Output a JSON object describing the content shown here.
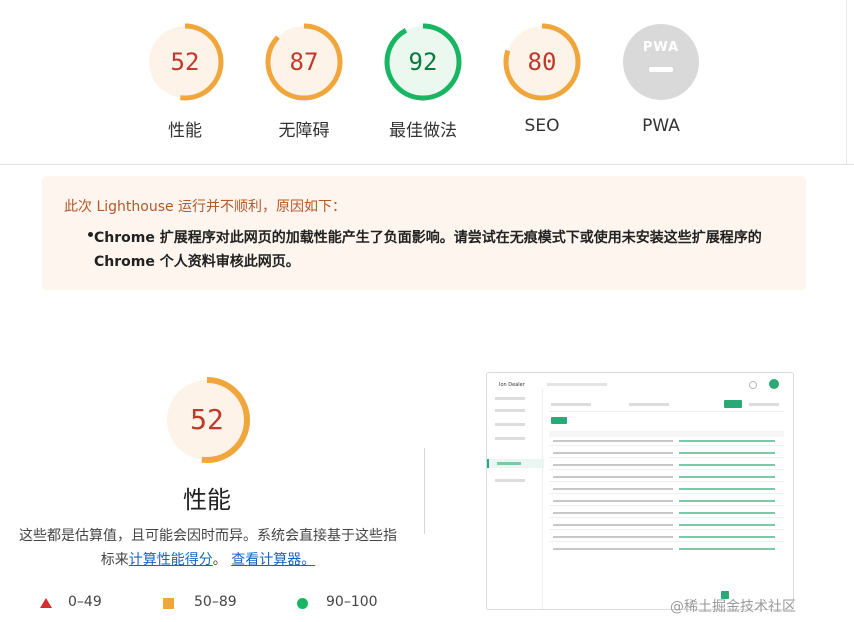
{
  "scores": [
    {
      "key": "performance",
      "value": "52",
      "label": "性能",
      "color": "#f0a63a",
      "fraction": 0.52
    },
    {
      "key": "accessibility",
      "value": "87",
      "label": "无障碍",
      "color": "#f0a63a",
      "fraction": 0.87
    },
    {
      "key": "best_practices",
      "value": "92",
      "label": "最佳做法",
      "color": "#18b663",
      "fraction": 0.92
    },
    {
      "key": "seo",
      "value": "80",
      "label": "SEO",
      "color": "#f0a63a",
      "fraction": 0.8
    },
    {
      "key": "pwa",
      "value": "PWA",
      "label": "PWA",
      "color": "#cccccc",
      "fraction": 0
    }
  ],
  "colors": {
    "orange": "#f0a63a",
    "green": "#18b663",
    "red": "#d32f2f",
    "text_orange": "#c0392b",
    "text_green": "#0b7a3e"
  },
  "warning": {
    "title": "此次 Lighthouse 运行并不顺利，原因如下：",
    "items": [
      "Chrome 扩展程序对此网页的加载性能产生了负面影响。请尝试在无痕模式下或使用未安装这些扩展程序的 Chrome 个人资料审核此网页。"
    ]
  },
  "performance": {
    "score": "52",
    "fraction": 0.52,
    "title": "性能",
    "desc_1": "这些都是估算值，且可能会因时而异。系统会直接基于这些指标来",
    "link_1": "计算性能得分",
    "desc_2": "。",
    "link_2": "查看计算器。"
  },
  "legend": [
    {
      "range": "0–49",
      "icon": "triangle-icon"
    },
    {
      "range": "50–89",
      "icon": "square-icon"
    },
    {
      "range": "90–100",
      "icon": "circle-icon"
    }
  ],
  "screenshot": {
    "brand": "Ion Dealer"
  },
  "watermark": "@稀土掘金技术社区"
}
